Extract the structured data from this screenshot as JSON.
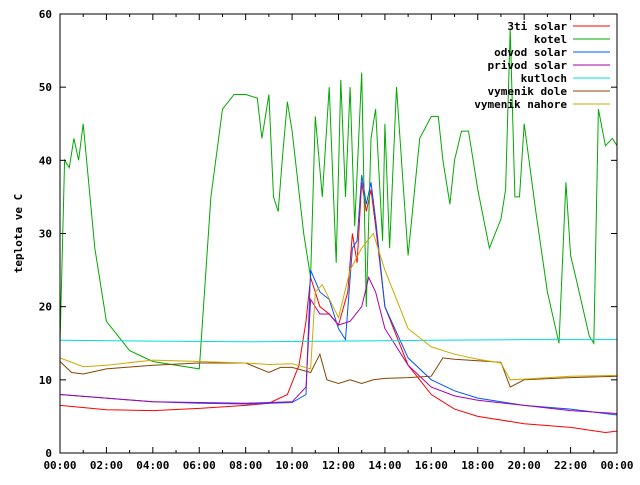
{
  "chart_data": {
    "type": "line",
    "ylabel": "teplota ve C",
    "xlabel": "",
    "ylim": [
      0,
      60
    ],
    "yticks": [
      0,
      10,
      20,
      30,
      40,
      50,
      60
    ],
    "xlim": [
      0,
      24
    ],
    "xticks": [
      "00:00",
      "02:00",
      "04:00",
      "06:00",
      "08:00",
      "10:00",
      "12:00",
      "14:00",
      "16:00",
      "18:00",
      "20:00",
      "22:00",
      "00:00"
    ],
    "legend_position": "top-right",
    "series": [
      {
        "name": "3ti solar",
        "color": "#ff0000",
        "points": [
          [
            0,
            6.5
          ],
          [
            2,
            5.9
          ],
          [
            4,
            5.8
          ],
          [
            6,
            6.1
          ],
          [
            8,
            6.5
          ],
          [
            9,
            6.8
          ],
          [
            9.8,
            8
          ],
          [
            10.3,
            12
          ],
          [
            10.6,
            18
          ],
          [
            10.8,
            24
          ],
          [
            11.2,
            20
          ],
          [
            11.6,
            19
          ],
          [
            12,
            17.5
          ],
          [
            12.4,
            22
          ],
          [
            12.6,
            30
          ],
          [
            12.8,
            26
          ],
          [
            13,
            37
          ],
          [
            13.2,
            33
          ],
          [
            13.4,
            36
          ],
          [
            13.6,
            31
          ],
          [
            14,
            20
          ],
          [
            15,
            12
          ],
          [
            16,
            8
          ],
          [
            17,
            6
          ],
          [
            18,
            5
          ],
          [
            20,
            4
          ],
          [
            22,
            3.5
          ],
          [
            23.5,
            2.8
          ],
          [
            24,
            3
          ]
        ]
      },
      {
        "name": "kotel",
        "color": "#00aa00",
        "points": [
          [
            0,
            15
          ],
          [
            0.2,
            40
          ],
          [
            0.4,
            39
          ],
          [
            0.6,
            43
          ],
          [
            0.8,
            40
          ],
          [
            1,
            45
          ],
          [
            1.5,
            28
          ],
          [
            2,
            18
          ],
          [
            3,
            14
          ],
          [
            4,
            12.5
          ],
          [
            6,
            11.5
          ],
          [
            6.5,
            35
          ],
          [
            7,
            47
          ],
          [
            7.5,
            49
          ],
          [
            8,
            49
          ],
          [
            8.5,
            48.5
          ],
          [
            8.7,
            43
          ],
          [
            9,
            49
          ],
          [
            9.2,
            35
          ],
          [
            9.4,
            33
          ],
          [
            9.6,
            41
          ],
          [
            9.8,
            48
          ],
          [
            10,
            44
          ],
          [
            10.5,
            30
          ],
          [
            10.8,
            24
          ],
          [
            11,
            46
          ],
          [
            11.3,
            35
          ],
          [
            11.6,
            50
          ],
          [
            11.9,
            26
          ],
          [
            12.1,
            51
          ],
          [
            12.3,
            35
          ],
          [
            12.5,
            50
          ],
          [
            12.7,
            31
          ],
          [
            13,
            52
          ],
          [
            13.2,
            20
          ],
          [
            13.4,
            43
          ],
          [
            13.6,
            47
          ],
          [
            13.9,
            29
          ],
          [
            14,
            45
          ],
          [
            14.2,
            28
          ],
          [
            14.5,
            50
          ],
          [
            14.8,
            36
          ],
          [
            15,
            27
          ],
          [
            15.5,
            43
          ],
          [
            16,
            46
          ],
          [
            16.3,
            46
          ],
          [
            16.5,
            40
          ],
          [
            16.8,
            34
          ],
          [
            17,
            40
          ],
          [
            17.3,
            44
          ],
          [
            17.6,
            44
          ],
          [
            18,
            36
          ],
          [
            18.5,
            28
          ],
          [
            19,
            32
          ],
          [
            19.2,
            36
          ],
          [
            19.4,
            58
          ],
          [
            19.6,
            35
          ],
          [
            19.8,
            35
          ],
          [
            20,
            45
          ],
          [
            20.5,
            33
          ],
          [
            21,
            22
          ],
          [
            21.5,
            15
          ],
          [
            21.8,
            37
          ],
          [
            22,
            27
          ],
          [
            22.3,
            23
          ],
          [
            22.8,
            16
          ],
          [
            23,
            15
          ],
          [
            23.2,
            47
          ],
          [
            23.5,
            42
          ],
          [
            23.8,
            43
          ],
          [
            24,
            42
          ]
        ]
      },
      {
        "name": "odvod solar",
        "color": "#0055ff",
        "points": [
          [
            0,
            8
          ],
          [
            2,
            7.5
          ],
          [
            4,
            7
          ],
          [
            6,
            6.8
          ],
          [
            8,
            6.7
          ],
          [
            10,
            6.9
          ],
          [
            10.6,
            8
          ],
          [
            10.8,
            25
          ],
          [
            11.2,
            22
          ],
          [
            11.6,
            21
          ],
          [
            12,
            17
          ],
          [
            12.3,
            15.5
          ],
          [
            12.6,
            28
          ],
          [
            12.8,
            29
          ],
          [
            13,
            38
          ],
          [
            13.2,
            34
          ],
          [
            13.4,
            37
          ],
          [
            13.6,
            32
          ],
          [
            14,
            20
          ],
          [
            15,
            13
          ],
          [
            16,
            10
          ],
          [
            17,
            8.5
          ],
          [
            18,
            7.5
          ],
          [
            20,
            6.5
          ],
          [
            22,
            6
          ],
          [
            24,
            5.2
          ]
        ]
      },
      {
        "name": "privod solar",
        "color": "#aa00aa",
        "points": [
          [
            0,
            8
          ],
          [
            2,
            7.5
          ],
          [
            4,
            7
          ],
          [
            6,
            6.9
          ],
          [
            8,
            6.8
          ],
          [
            10,
            7
          ],
          [
            10.6,
            9
          ],
          [
            10.8,
            21
          ],
          [
            11.2,
            19
          ],
          [
            11.6,
            19
          ],
          [
            12,
            17.5
          ],
          [
            12.5,
            18
          ],
          [
            13,
            20
          ],
          [
            13.3,
            24
          ],
          [
            13.6,
            22
          ],
          [
            14,
            17
          ],
          [
            15,
            12
          ],
          [
            16,
            9
          ],
          [
            17,
            7.8
          ],
          [
            18,
            7.2
          ],
          [
            20,
            6.5
          ],
          [
            22,
            5.8
          ],
          [
            24,
            5.4
          ]
        ]
      },
      {
        "name": "kutloch",
        "color": "#00dddd",
        "points": [
          [
            0,
            15.4
          ],
          [
            4,
            15.3
          ],
          [
            8,
            15.2
          ],
          [
            12,
            15.3
          ],
          [
            16,
            15.4
          ],
          [
            20,
            15.5
          ],
          [
            24,
            15.5
          ]
        ]
      },
      {
        "name": "vymenik dole",
        "color": "#884400",
        "points": [
          [
            0,
            12.5
          ],
          [
            0.5,
            11
          ],
          [
            1,
            10.8
          ],
          [
            2,
            11.5
          ],
          [
            4,
            12
          ],
          [
            6,
            12.3
          ],
          [
            8,
            12.3
          ],
          [
            9,
            11
          ],
          [
            9.5,
            11.7
          ],
          [
            10,
            11.7
          ],
          [
            10.8,
            11
          ],
          [
            11.2,
            13.5
          ],
          [
            11.5,
            10
          ],
          [
            12,
            9.5
          ],
          [
            12.5,
            10
          ],
          [
            13,
            9.5
          ],
          [
            13.5,
            10
          ],
          [
            14,
            10.2
          ],
          [
            15,
            10.3
          ],
          [
            16,
            10.5
          ],
          [
            16.5,
            13
          ],
          [
            17,
            12.8
          ],
          [
            18,
            12.6
          ],
          [
            19,
            12.4
          ],
          [
            19.4,
            9
          ],
          [
            20,
            10
          ],
          [
            22,
            10.3
          ],
          [
            24,
            10.5
          ]
        ]
      },
      {
        "name": "vymenik nahore",
        "color": "#ccaa00",
        "points": [
          [
            0,
            13
          ],
          [
            1,
            11.8
          ],
          [
            2,
            12
          ],
          [
            4,
            12.7
          ],
          [
            6,
            12.5
          ],
          [
            8,
            12.3
          ],
          [
            9,
            12.1
          ],
          [
            10,
            12.2
          ],
          [
            10.8,
            11.5
          ],
          [
            11,
            22
          ],
          [
            11.3,
            23
          ],
          [
            12,
            18.5
          ],
          [
            12.5,
            25
          ],
          [
            13,
            28
          ],
          [
            13.5,
            30
          ],
          [
            14,
            25
          ],
          [
            15,
            17
          ],
          [
            16,
            14.5
          ],
          [
            17,
            13.5
          ],
          [
            18,
            12.8
          ],
          [
            19,
            12.3
          ],
          [
            19.4,
            10
          ],
          [
            20,
            10.1
          ],
          [
            22,
            10.5
          ],
          [
            24,
            10.6
          ]
        ]
      }
    ]
  }
}
